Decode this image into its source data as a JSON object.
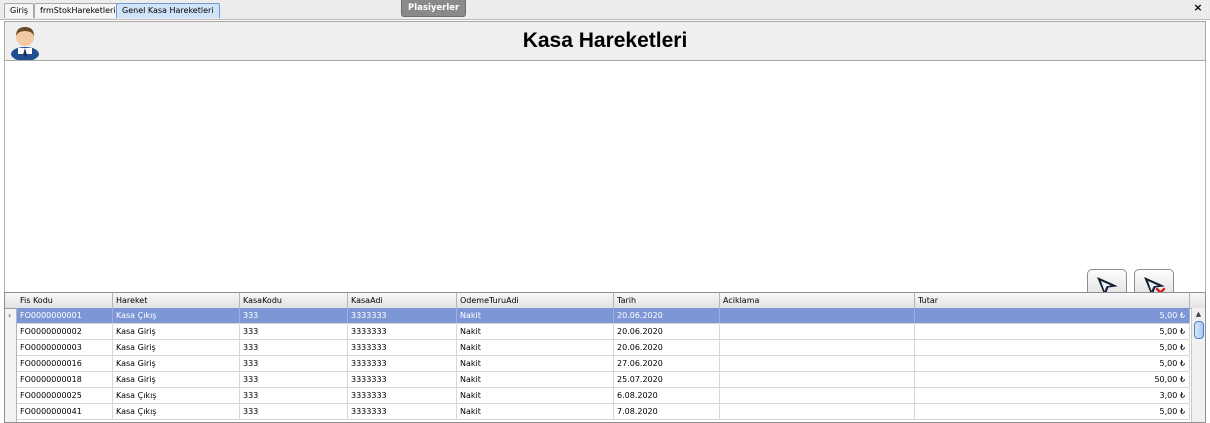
{
  "tabs": [
    {
      "label": "Giriş"
    },
    {
      "label": "frmStokHareketleri"
    },
    {
      "label": "Genel Kasa Hareketleri"
    }
  ],
  "floating_tab": "Plasiyerler",
  "close_symbol": "×",
  "header": {
    "title": "Kasa Hareketleri"
  },
  "icons": {
    "avatar": "user-avatar-icon",
    "filter": "filter-funnel-icon",
    "clear_filter": "filter-clear-icon"
  },
  "colors": {
    "selected_row": "#7d97d6",
    "active_tab": "#cfe3fb"
  },
  "grid": {
    "columns": [
      "Fis Kodu",
      "Hareket",
      "KasaKodu",
      "KasaAdi",
      "OdemeTuruAdi",
      "Tarih",
      "Aciklama",
      "Tutar"
    ],
    "rows": [
      [
        "FO0000000001",
        "Kasa Çıkış",
        "333",
        "3333333",
        "Nakit",
        "20.06.2020",
        "",
        "5,00 ₺"
      ],
      [
        "FO0000000002",
        "Kasa Giriş",
        "333",
        "3333333",
        "Nakit",
        "20.06.2020",
        "",
        "5,00 ₺"
      ],
      [
        "FO0000000003",
        "Kasa Giriş",
        "333",
        "3333333",
        "Nakit",
        "20.06.2020",
        "",
        "5,00 ₺"
      ],
      [
        "FO0000000016",
        "Kasa Giriş",
        "333",
        "3333333",
        "Nakit",
        "27.06.2020",
        "",
        "5,00 ₺"
      ],
      [
        "FO0000000018",
        "Kasa Giriş",
        "333",
        "3333333",
        "Nakit",
        "25.07.2020",
        "",
        "50,00 ₺"
      ],
      [
        "FO0000000025",
        "Kasa Çıkış",
        "333",
        "3333333",
        "Nakit",
        "6.08.2020",
        "",
        "3,00 ₺"
      ],
      [
        "FO0000000041",
        "Kasa Çıkış",
        "333",
        "3333333",
        "Nakit",
        "7.08.2020",
        "",
        "5,00 ₺"
      ]
    ],
    "selected_row": 0
  }
}
